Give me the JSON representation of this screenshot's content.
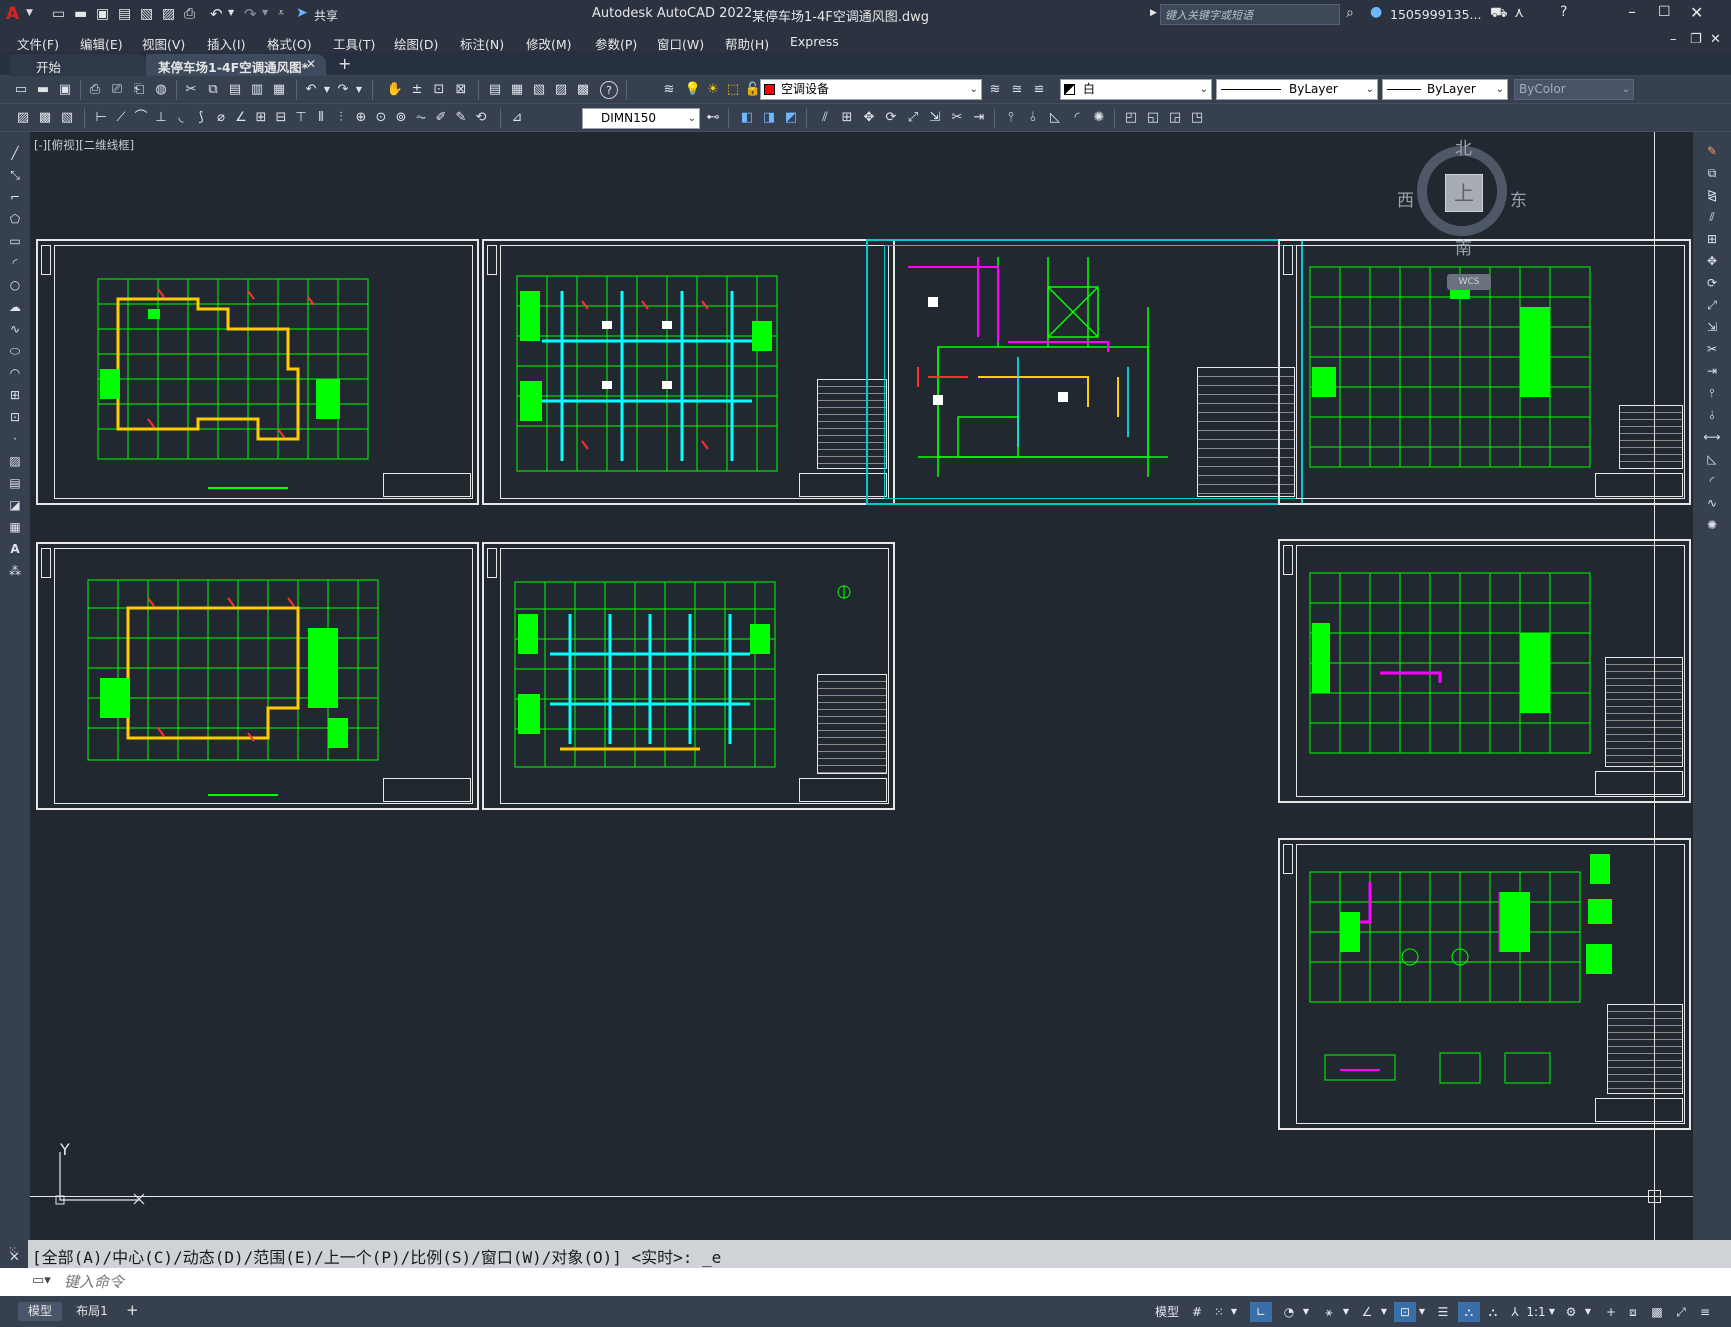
{
  "titlebar": {
    "app_title": "Autodesk AutoCAD 2022",
    "file_title": "某停车场1-4F空调通风图.dwg",
    "share_label": "共享",
    "search_placeholder": "键入关键字或短语",
    "user_name": "1505999135...",
    "app_letter": "A"
  },
  "menu": {
    "items": [
      "文件(F)",
      "编辑(E)",
      "视图(V)",
      "插入(I)",
      "格式(O)",
      "工具(T)",
      "绘图(D)",
      "标注(N)",
      "修改(M)",
      "参数(P)",
      "窗口(W)",
      "帮助(H)",
      "Express"
    ]
  },
  "tabs": {
    "start": "开始",
    "active": "某停车场1-4F空调通风图*",
    "add": "+"
  },
  "toolbar1": {
    "layer_name": "空调设备",
    "layer_color": "#ff0000",
    "color_value": "白",
    "linetype": "ByLayer",
    "lineweight": "ByLayer",
    "plotstyle": "ByColor"
  },
  "toolbar2": {
    "dimstyle": "DIMN150"
  },
  "viewport": {
    "label": "[-][俯视][二维线框]",
    "viewcube": {
      "north": "北",
      "south": "南",
      "east": "东",
      "west": "西",
      "top": "上",
      "wcs": "WCS"
    },
    "ucs": {
      "y_label": "Y",
      "x_label": "X"
    }
  },
  "command": {
    "history": "[全部(A)/中心(C)/动态(D)/范围(E)/上一个(P)/比例(S)/窗口(W)/对象(O)] <实时>: _e",
    "placeholder": "键入命令"
  },
  "status": {
    "model_tab": "模型",
    "layout_tab": "布局1",
    "model_label": "模型",
    "scale": "1:1"
  },
  "colors": {
    "canvas_bg": "#212830",
    "grid_green": "#00ff00",
    "duct_cyan": "#00ffff",
    "duct_yellow": "#ffcc00",
    "accent_magenta": "#ff00ff",
    "selected_frame": "#00cccc"
  }
}
